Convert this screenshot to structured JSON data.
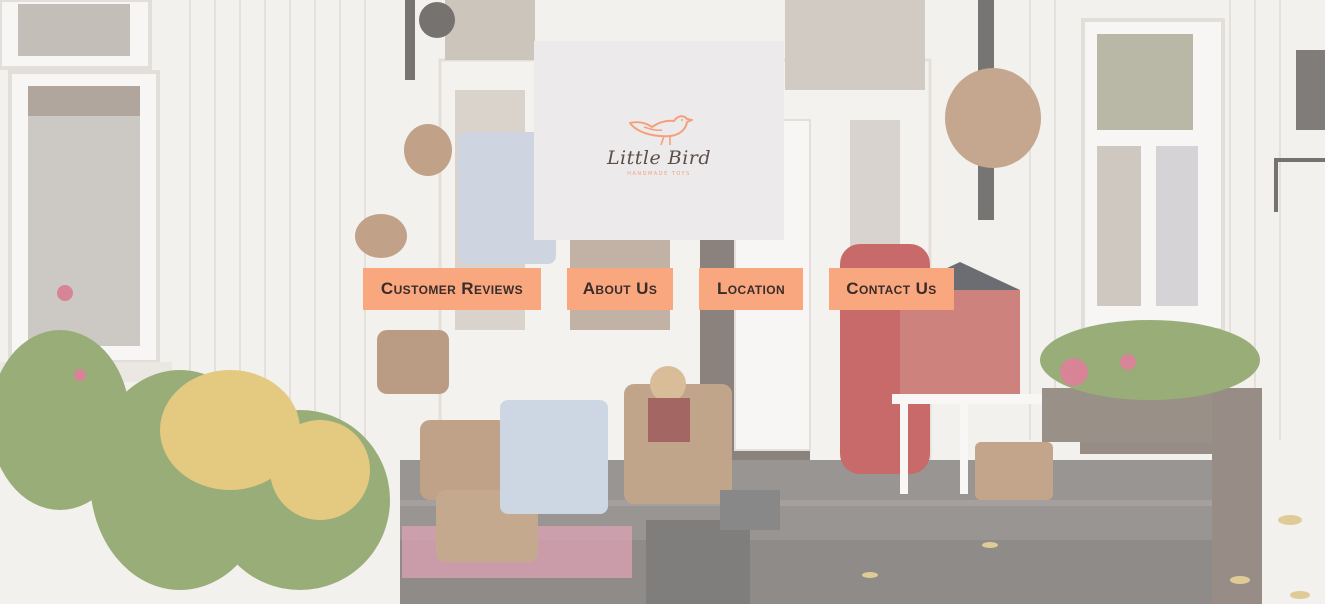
{
  "brand": {
    "name": "Little Bird",
    "tagline": "HANDMADE TOYS",
    "accent_color": "#f9a77f",
    "bird_color": "#f3a07b"
  },
  "nav": {
    "items": [
      {
        "label": "Customer Reviews"
      },
      {
        "label": "About Us"
      },
      {
        "label": "Location"
      },
      {
        "label": "Contact Us"
      }
    ]
  },
  "hero": {
    "icon": "shopfront-photo"
  }
}
